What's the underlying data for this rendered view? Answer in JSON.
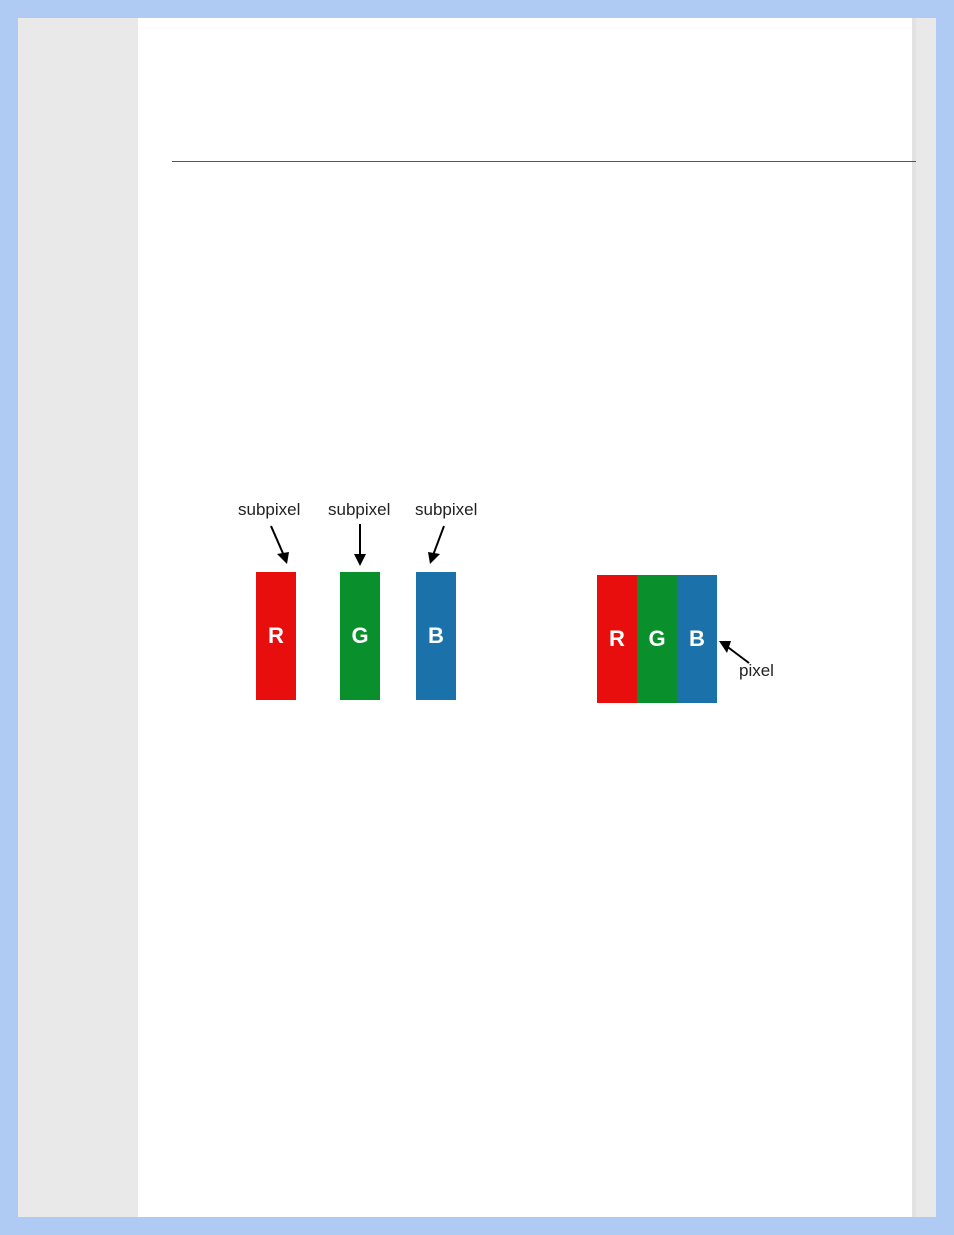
{
  "diagram": {
    "subpixels": [
      {
        "label": "subpixel",
        "letter": "R",
        "color": "red"
      },
      {
        "label": "subpixel",
        "letter": "G",
        "color": "green"
      },
      {
        "label": "subpixel",
        "letter": "B",
        "color": "blue"
      }
    ],
    "pixel": {
      "label": "pixel",
      "letters": [
        "R",
        "G",
        "B"
      ],
      "colors": [
        "red",
        "green",
        "blue"
      ]
    }
  }
}
